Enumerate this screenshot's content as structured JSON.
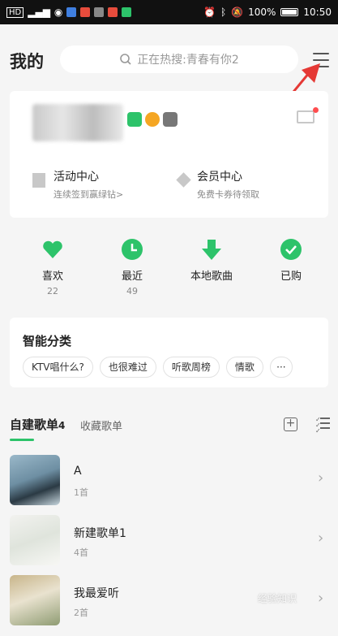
{
  "statusbar": {
    "battery_pct": "100%",
    "time": "10:50",
    "carrier": "HD"
  },
  "header": {
    "title": "我的",
    "search_placeholder": "正在热搜:青春有你2"
  },
  "profile": {
    "entries": [
      {
        "title": "活动中心",
        "sub": "连续签到赢绿钻>"
      },
      {
        "title": "会员中心",
        "sub": "免费卡券待领取"
      }
    ]
  },
  "quick_actions": [
    {
      "label": "喜欢",
      "count": "22",
      "icon": "heart-icon"
    },
    {
      "label": "最近",
      "count": "49",
      "icon": "clock-icon"
    },
    {
      "label": "本地歌曲",
      "count": "",
      "icon": "download-arrow-icon"
    },
    {
      "label": "已购",
      "count": "",
      "icon": "check-icon"
    }
  ],
  "smart_category": {
    "title": "智能分类",
    "tags": [
      "KTV唱什么?",
      "也很难过",
      "听歌周榜",
      "情歌",
      "···"
    ]
  },
  "playlist_tabs": {
    "own": "自建歌单",
    "own_count": "4",
    "fav": "收藏歌单"
  },
  "playlists": [
    {
      "name": "A",
      "count": "1首"
    },
    {
      "name": "新建歌单1",
      "count": "4首"
    },
    {
      "name": "我最爱听",
      "count": "2首"
    }
  ],
  "colors": {
    "accent": "#2dc36a",
    "background": "#f5f5f5",
    "alert": "#ff4d4f",
    "annotation_arrow": "#e53935"
  },
  "watermark": "经验知识"
}
